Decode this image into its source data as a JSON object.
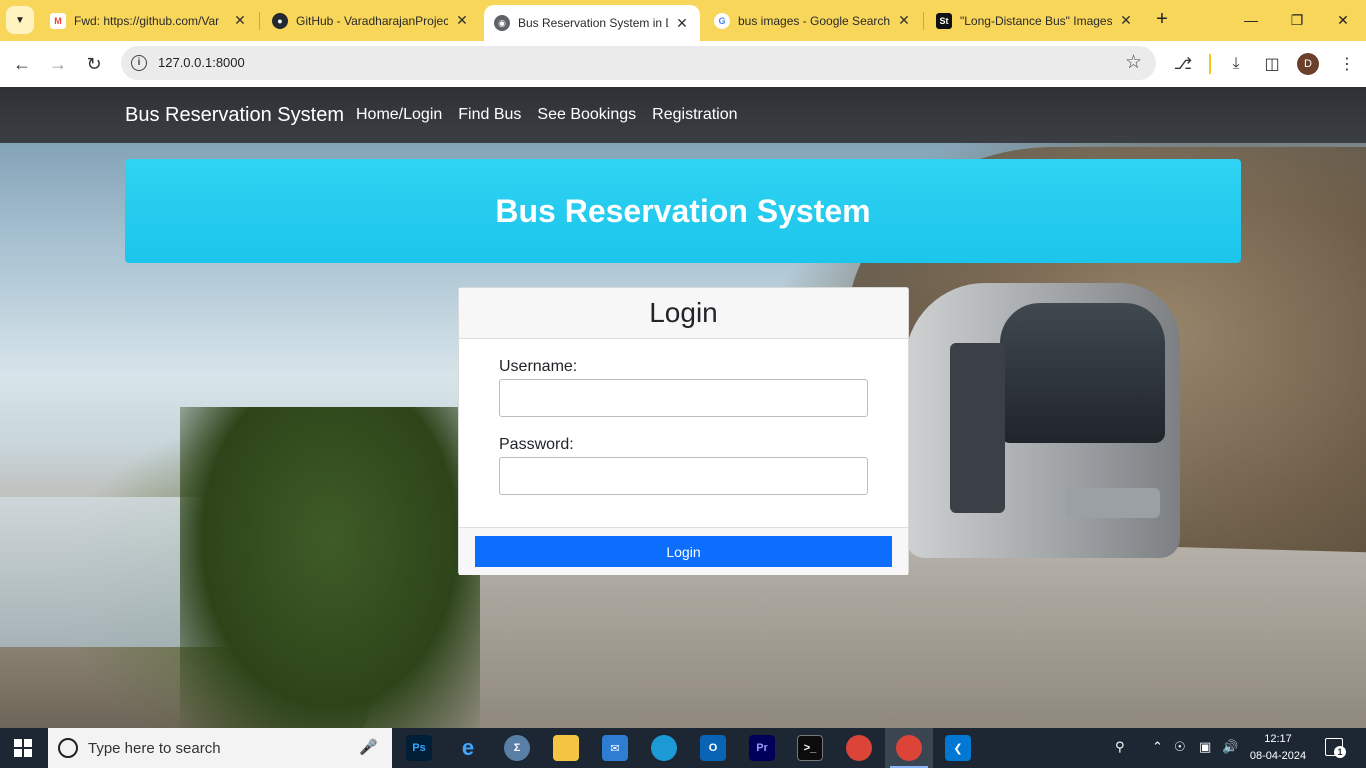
{
  "browser": {
    "tabs": [
      {
        "title": "Fwd: https://github.com/Var",
        "icon": "gmail-icon",
        "active": false
      },
      {
        "title": "GitHub - VaradharajanProjec",
        "icon": "github-icon",
        "active": false
      },
      {
        "title": "Bus Reservation System in D",
        "icon": "globe-icon",
        "active": true
      },
      {
        "title": "bus images - Google Search",
        "icon": "google-icon",
        "active": false
      },
      {
        "title": "\"Long-Distance Bus\" Images",
        "icon": "shutterstock-icon",
        "active": false
      }
    ],
    "url": "127.0.0.1:8000",
    "profile_initial": "D",
    "accent_color": "#f8d65a"
  },
  "navbar": {
    "brand": "Bus Reservation System",
    "links": [
      "Home/Login",
      "Find Bus",
      "See Bookings",
      "Registration"
    ]
  },
  "header": {
    "title": "Bus Reservation System"
  },
  "login": {
    "title": "Login",
    "username_label": "Username:",
    "username_value": "",
    "password_label": "Password:",
    "password_value": "",
    "button_label": "Login",
    "button_color": "#0d6efd"
  },
  "taskbar": {
    "search_placeholder": "Type here to search",
    "apps": [
      "Ps",
      "Pr"
    ],
    "time": "12:17",
    "date": "08-04-2024",
    "notification_count": "1"
  }
}
